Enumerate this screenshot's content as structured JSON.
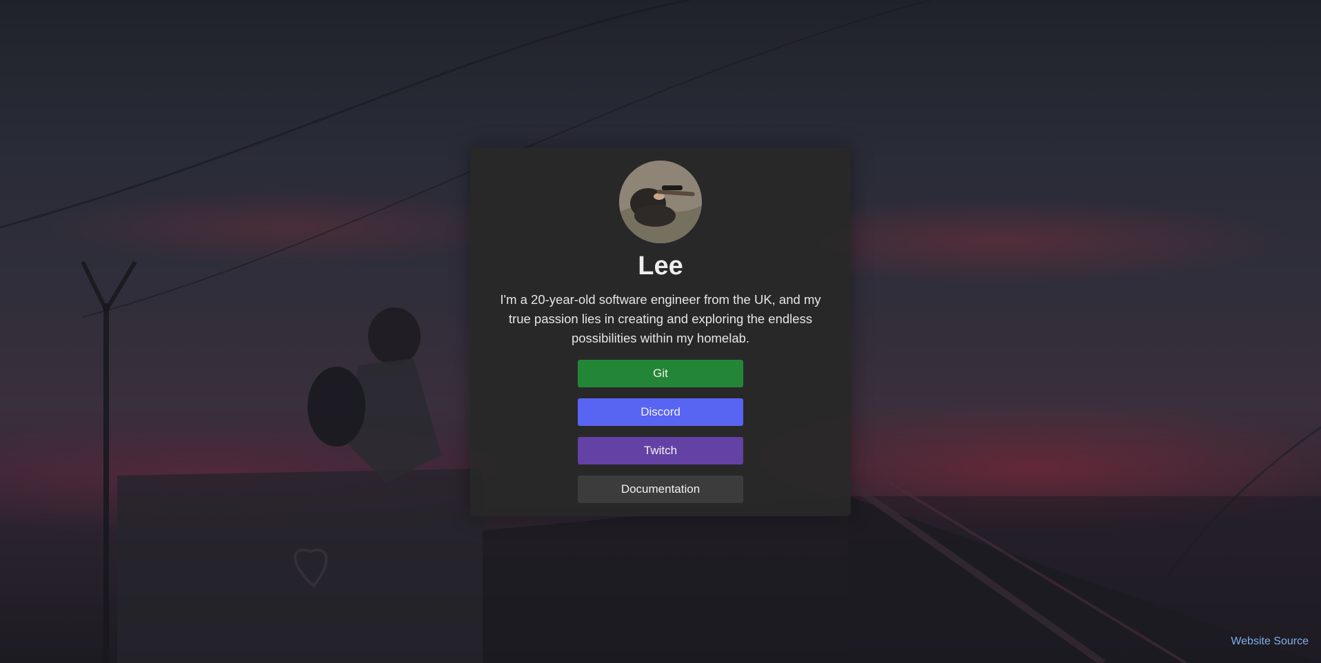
{
  "profile": {
    "name": "Lee",
    "bio": "I'm a 20-year-old software engineer from the UK, and my true passion lies in creating and exploring the endless possibilities within my homelab.",
    "avatar_icon": "avatar-photo"
  },
  "links": [
    {
      "label": "Git",
      "color": "#238636"
    },
    {
      "label": "Discord",
      "color": "#5865f2"
    },
    {
      "label": "Twitch",
      "color": "#6441a5"
    },
    {
      "label": "Documentation",
      "color": "#3c3c3c"
    }
  ],
  "footer": {
    "source_label": "Website Source",
    "source_color": "#7fb0ec"
  },
  "card_color": "#282828"
}
